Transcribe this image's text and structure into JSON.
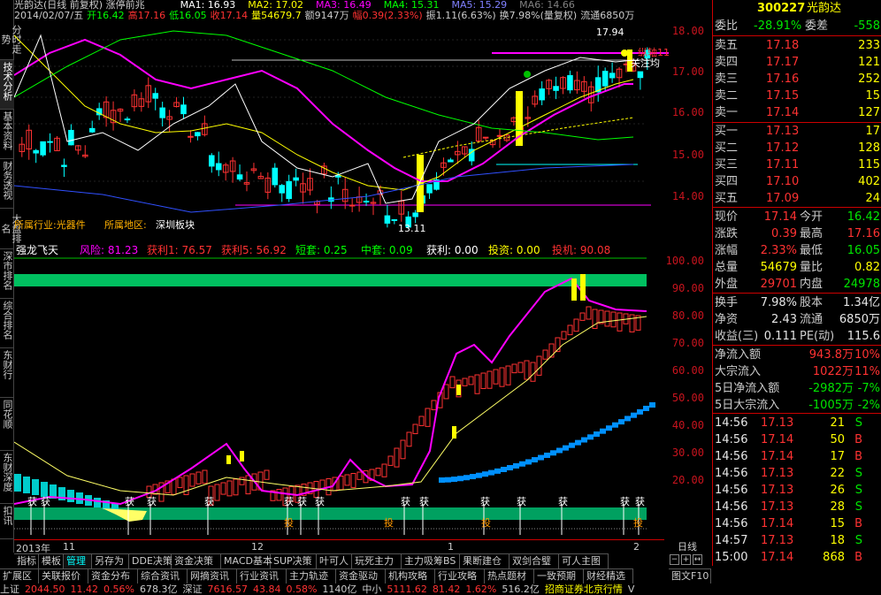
{
  "left_tabs": [
    "分时走势",
    "技术分析",
    "基本资料",
    "财务透视",
    "大盘排名",
    "深市排名",
    "综合排名",
    "东财行",
    "同花顺",
    "东财深度",
    "扣讯"
  ],
  "header": {
    "stock_name": "光韵达(日线 前复权) 涨停前兆",
    "ma_line": [
      {
        "label": "MA1: 16.93",
        "color": "#ffffff"
      },
      {
        "label": "MA2: 17.02",
        "color": "#ffff00"
      },
      {
        "label": "MA3: 16.49",
        "color": "#ff00ff"
      },
      {
        "label": "MA4: 15.31",
        "color": "#00ff00"
      },
      {
        "label": "MA5: 15.29",
        "color": "#8080ff"
      },
      {
        "label": "MA6: 14.66",
        "color": "#808080"
      }
    ],
    "ohlc_line": [
      {
        "label": "2014/02/07/五",
        "color": "#cccccc"
      },
      {
        "label": "开16.42",
        "color": "#00ff00"
      },
      {
        "label": "高17.16",
        "color": "#ff3232"
      },
      {
        "label": "低16.05",
        "color": "#00ff00"
      },
      {
        "label": "收17.14",
        "color": "#ff3232"
      },
      {
        "label": "量54679.7",
        "color": "#ffff00"
      },
      {
        "label": "额9147万",
        "color": "#cccccc"
      },
      {
        "label": "幅0.39(2.33%)",
        "color": "#ff3232"
      },
      {
        "label": "振1.11(6.63%)",
        "color": "#cccccc"
      },
      {
        "label": "换7.98%(量复权)",
        "color": "#cccccc"
      },
      {
        "label": "流通6850万",
        "color": "#cccccc"
      }
    ]
  },
  "main_chart": {
    "annotations": {
      "high_label": "17.94",
      "low_label": "13.11",
      "marker1": "纵轴11",
      "marker2": "关注均",
      "industry": "所属行业:光器件",
      "region_label": "所属地区:",
      "region_value": "深圳板块"
    },
    "price_ticks": [
      "18.00",
      "17.00",
      "16.00",
      "15.00",
      "14.00"
    ]
  },
  "indicator": {
    "name": "强龙飞天",
    "values": [
      {
        "label": "风险: 81.23",
        "color": "#ff00ff"
      },
      {
        "label": "获利1: 76.57",
        "color": "#ff3232"
      },
      {
        "label": "获利5: 56.92",
        "color": "#ff3232"
      },
      {
        "label": "短套: 0.25",
        "color": "#00ff00"
      },
      {
        "label": "中套: 0.09",
        "color": "#00ff00"
      },
      {
        "label": "获利: 0.00",
        "color": "#ffffff"
      },
      {
        "label": "投资: 0.00",
        "color": "#ffff00"
      },
      {
        "label": "投机: 90.08",
        "color": "#ff3232"
      }
    ],
    "ticks": [
      "100.00",
      "90.00",
      "80.00",
      "70.00",
      "60.00",
      "50.00",
      "40.00",
      "30.00",
      "20.00"
    ],
    "marker_huo": "获",
    "marker_tou": "投"
  },
  "date_axis": [
    "2013年",
    "11",
    "12",
    "1",
    "2"
  ],
  "period": "日线",
  "quote": {
    "code": "300227",
    "name": "光韵达",
    "weibi_label": "委比",
    "weibi_value": "-28.91%",
    "weicha_label": "委差",
    "weicha_value": "-558",
    "asks": [
      {
        "label": "卖五",
        "price": "17.18",
        "vol": "233"
      },
      {
        "label": "卖四",
        "price": "17.17",
        "vol": "121"
      },
      {
        "label": "卖三",
        "price": "17.16",
        "vol": "252"
      },
      {
        "label": "卖二",
        "price": "17.15",
        "vol": "15"
      },
      {
        "label": "卖一",
        "price": "17.14",
        "vol": "127"
      }
    ],
    "bids": [
      {
        "label": "买一",
        "price": "17.13",
        "vol": "17"
      },
      {
        "label": "买二",
        "price": "17.12",
        "vol": "128"
      },
      {
        "label": "买三",
        "price": "17.11",
        "vol": "115"
      },
      {
        "label": "买四",
        "price": "17.10",
        "vol": "402"
      },
      {
        "label": "买五",
        "price": "17.09",
        "vol": "24"
      }
    ],
    "stats": [
      {
        "l1": "现价",
        "v1": "17.14",
        "c1": "red",
        "l2": "今开",
        "v2": "16.42",
        "c2": "green"
      },
      {
        "l1": "涨跌",
        "v1": "0.39",
        "c1": "red",
        "l2": "最高",
        "v2": "17.16",
        "c2": "red"
      },
      {
        "l1": "涨幅",
        "v1": "2.33%",
        "c1": "red",
        "l2": "最低",
        "v2": "16.05",
        "c2": "green"
      },
      {
        "l1": "总量",
        "v1": "54679",
        "c1": "yellow",
        "l2": "量比",
        "v2": "0.82",
        "c2": "yellow"
      },
      {
        "l1": "外盘",
        "v1": "29701",
        "c1": "red",
        "l2": "内盘",
        "v2": "24978",
        "c2": "green"
      }
    ],
    "stats2": [
      {
        "l1": "换手",
        "v1": "7.98%",
        "l2": "股本",
        "v2": "1.34亿"
      },
      {
        "l1": "净资",
        "v1": "2.43",
        "l2": "流通",
        "v2": "6850万"
      },
      {
        "l1": "收益(三)",
        "v1": "0.111",
        "l2": "PE(动)",
        "v2": "115.6"
      }
    ],
    "flows": [
      {
        "label": "净流入额",
        "v1": "943.8万",
        "c1": "red",
        "v2": "10%",
        "c2": "red"
      },
      {
        "label": "大宗流入",
        "v1": "1022万",
        "c1": "red",
        "v2": "11%",
        "c2": "red"
      },
      {
        "label": "5日净流入额",
        "v1": "-2982万",
        "c1": "green",
        "v2": "-7%",
        "c2": "green"
      },
      {
        "label": "5日大宗流入",
        "v1": "-1005万",
        "c1": "green",
        "v2": "-2%",
        "c2": "green"
      }
    ],
    "ticks": [
      {
        "time": "14:56",
        "price": "17.13",
        "vol": "21",
        "side": "S"
      },
      {
        "time": "14:56",
        "price": "17.14",
        "vol": "50",
        "side": "B"
      },
      {
        "time": "14:56",
        "price": "17.14",
        "vol": "17",
        "side": "B"
      },
      {
        "time": "14:56",
        "price": "17.13",
        "vol": "22",
        "side": "S"
      },
      {
        "time": "14:56",
        "price": "17.13",
        "vol": "26",
        "side": "S"
      },
      {
        "time": "14:56",
        "price": "17.13",
        "vol": "28",
        "side": "S"
      },
      {
        "time": "14:56",
        "price": "17.14",
        "vol": "15",
        "side": "B"
      },
      {
        "time": "14:57",
        "price": "17.13",
        "vol": "18",
        "side": "S"
      },
      {
        "time": "15:00",
        "price": "17.14",
        "vol": "868",
        "side": "B"
      }
    ],
    "bottom_tabs": [
      "笔",
      "价",
      "细",
      "势",
      "联",
      "值",
      "主",
      "筹"
    ]
  },
  "tabs_row1": [
    "指标",
    "模板",
    "管理",
    "另存为",
    "DDE决策",
    "资金决策",
    "MACD基本",
    "SUP决策",
    "叶可人",
    "玩死主力",
    "主力吸筹BS",
    "果断建仓",
    "双剑合璧",
    "可人主图"
  ],
  "tabs_row1_active": "管理",
  "tabs_row2": [
    "扩展区",
    "关联报价",
    "资金分布",
    "综合资讯",
    "网摘资讯",
    "行业资讯",
    "主力轨迹",
    "资金驱动",
    "机构攻略",
    "行业攻略",
    "热点题材",
    "一致预期",
    "财经精选"
  ],
  "tabs_row2_right": "图文F10",
  "status": [
    {
      "text": "上证",
      "color": "#cccccc"
    },
    {
      "text": "2044.50",
      "color": "#ff3232"
    },
    {
      "text": "11.42",
      "color": "#ff3232"
    },
    {
      "text": "0.56%",
      "color": "#ff3232"
    },
    {
      "text": "678.3亿",
      "color": "#cccccc"
    },
    {
      "text": "深证",
      "color": "#cccccc"
    },
    {
      "text": "7616.57",
      "color": "#ff3232"
    },
    {
      "text": "43.84",
      "color": "#ff3232"
    },
    {
      "text": "0.58%",
      "color": "#ff3232"
    },
    {
      "text": "1140亿",
      "color": "#cccccc"
    },
    {
      "text": "中小",
      "color": "#cccccc"
    },
    {
      "text": "5111.62",
      "color": "#ff3232"
    },
    {
      "text": "81.42",
      "color": "#ff3232"
    },
    {
      "text": "1.62%",
      "color": "#ff3232"
    },
    {
      "text": "516.2亿",
      "color": "#cccccc"
    },
    {
      "text": "招商证券北京行情",
      "color": "#ffff00"
    },
    {
      "text": "V",
      "color": "#cccccc"
    }
  ]
}
